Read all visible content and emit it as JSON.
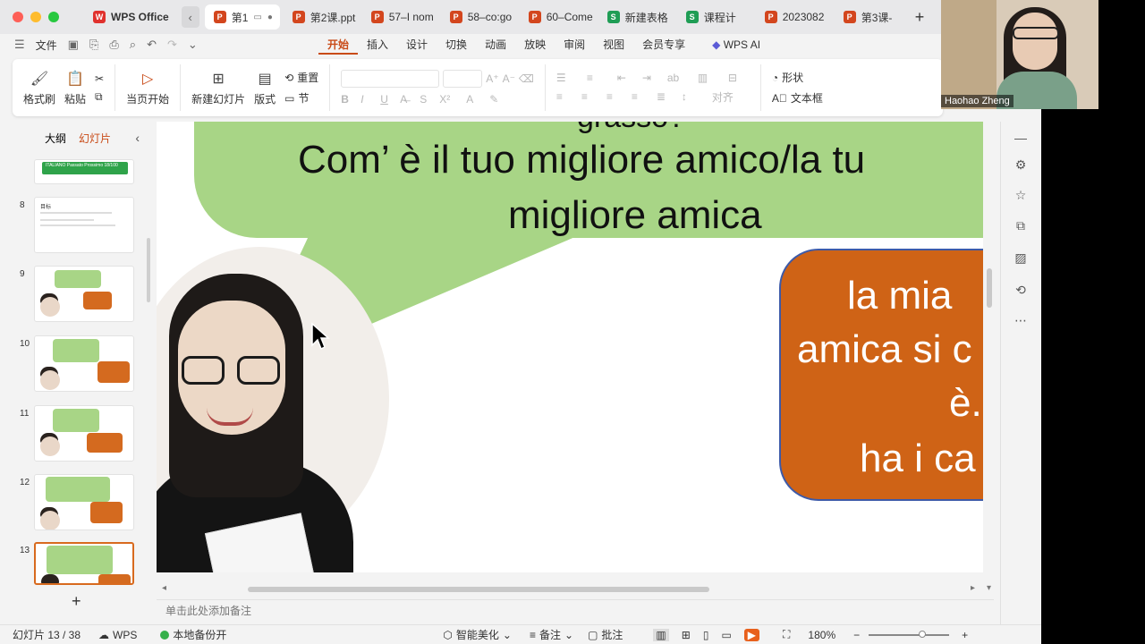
{
  "tabs": {
    "brand": "WPS Office",
    "items": [
      {
        "label": "第1",
        "icon": "P",
        "active": true
      },
      {
        "label": "第2课.ppt",
        "icon": "P"
      },
      {
        "label": "57–I nom",
        "icon": "P"
      },
      {
        "label": "58–co:go",
        "icon": "P"
      },
      {
        "label": "60–Come",
        "icon": "P"
      },
      {
        "label": "新建表格",
        "icon": "S"
      },
      {
        "label": "课程计",
        "icon": "S"
      },
      {
        "label": "2023082",
        "icon": "P"
      },
      {
        "label": "第3课-",
        "icon": "P"
      }
    ]
  },
  "menu": {
    "file": "文件",
    "items": [
      "开始",
      "插入",
      "设计",
      "切换",
      "动画",
      "放映",
      "审阅",
      "视图",
      "会员专享"
    ],
    "ai": "WPS AI"
  },
  "ribbon": {
    "format_painter": "格式刷",
    "paste": "粘贴",
    "play_current": "当页开始",
    "new_slide": "新建幻灯片",
    "layout": "版式",
    "reset": "重置",
    "section": "节",
    "align": "对齐",
    "shape": "形状",
    "textbox": "文本框"
  },
  "left_panel": {
    "outline_tab": "大纲",
    "slides_tab": "幻灯片",
    "thumb_top_title": "ITALIANO Passato Prossimo 18/100",
    "thumb8_title": "目标",
    "slide_numbers": [
      "8",
      "9",
      "10",
      "11",
      "12",
      "13"
    ]
  },
  "slide": {
    "top_partial": "grasso?",
    "question_line1": "Com’ è il tuo migliore amico/la tu",
    "question_line2": "migliore amica",
    "answer_line1": "la mia",
    "answer_line2": "amica si c",
    "answer_line3": "è..",
    "answer_line4": "ha i ca"
  },
  "notes_placeholder": "单击此处添加备注",
  "status": {
    "slide_counter": "幻灯片 13 / 38",
    "wps": "WPS",
    "backup": "本地备份开",
    "beautify": "智能美化",
    "notes": "备注",
    "comments": "批注",
    "zoom": "180%"
  },
  "webcam": {
    "name": "Haohao Zheng"
  },
  "colors": {
    "accent": "#c94b18",
    "green_bubble": "#a8d586",
    "orange_bubble": "#cf6316"
  }
}
